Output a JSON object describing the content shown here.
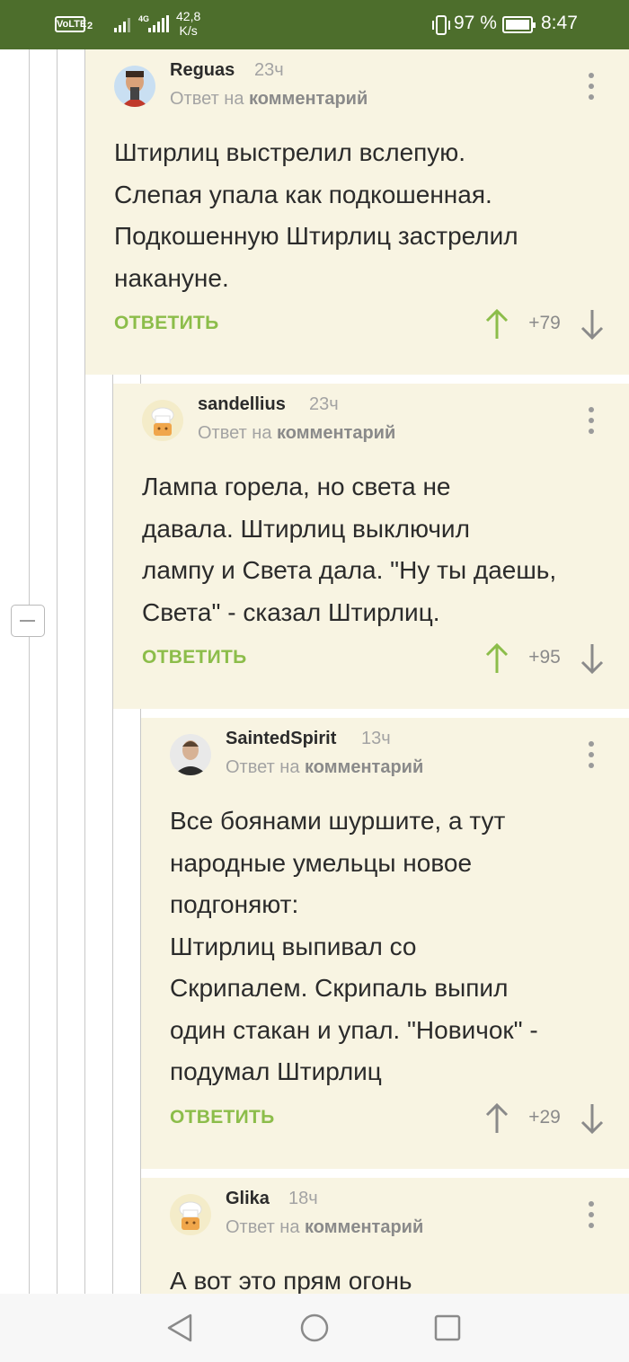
{
  "status_bar": {
    "volte": "VoLTE",
    "volte_sim": "2",
    "network_type": "4G",
    "speed_value": "42,8",
    "speed_unit": "K/s",
    "battery_percent": "97 %",
    "time": "8:47",
    "colors": {
      "background": "#4d6e2c"
    }
  },
  "thread": {
    "collapse_icon": "minus-icon",
    "reply_label": "ОТВЕТИТЬ",
    "reply_to_prefix": "Ответ на",
    "reply_to_link": "комментарий",
    "colors": {
      "card": "#f8f4e2",
      "accent": "#8cbd4a",
      "up_active": "#8cbd4a",
      "vote_neutral": "#8a8a8a"
    },
    "comments": [
      {
        "username": "Reguas",
        "time_ago": "23ч",
        "avatar": "photo-avatar",
        "text": "Штирлиц выстрелил вслепую.\nСлепая упала как подкошенная.\nПодкошенную Штирлиц застрелил\nнакануне.",
        "rating": "+79",
        "upvoted": true
      },
      {
        "username": "sandellius",
        "time_ago": "23ч",
        "avatar": "chef-hat-avatar",
        "text": "Лампа горела, но света  не\nдавала. Штирлиц выключил\nлампу и Света дала. \"Ну ты даешь,\nСвета\" - сказал Штирлиц.",
        "rating": "+95",
        "upvoted": true
      },
      {
        "username": "SaintedSpirit",
        "time_ago": "13ч",
        "avatar": "photo-avatar",
        "text": "Все боянами шуршите, а тут\nнародные умельцы новое\nподгоняют:\nШтирлиц выпивал со\nСкрипалем. Скрипаль выпил\nодин стакан и упал. \"Новичок\" -\nподумал Штирлиц",
        "rating": "+29",
        "upvoted": false
      },
      {
        "username": "Glika",
        "time_ago": "18ч",
        "avatar": "chef-hat-avatar",
        "text": "А вот это прям огонь",
        "rating": "",
        "upvoted": false
      }
    ]
  },
  "nav_bar": {
    "back": "back-triangle-icon",
    "home": "home-circle-icon",
    "recents": "recents-square-icon"
  }
}
